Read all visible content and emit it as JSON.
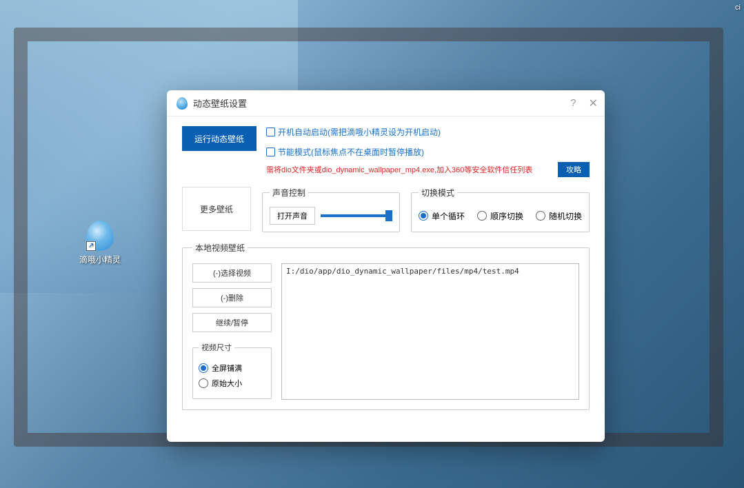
{
  "corner": "ci",
  "desktop_icon": {
    "label": "滴哦小精灵"
  },
  "dialog": {
    "title": "动态壁纸设置",
    "run_button": "运行动态壁纸",
    "autostart_label": "开机自动启动(需把滴哦小精灵设为开机启动)",
    "energy_label": "节能模式(鼠标焦点不在桌面时暂停播放)",
    "warn_text": "需将dio文件夹或dio_dynamic_wallpaper_mp4.exe,加入360等安全软件信任列表",
    "strategy_button": "攻略",
    "more_button": "更多壁纸",
    "audio": {
      "legend": "声音控制",
      "open_button": "打开声音",
      "value": 100
    },
    "switch": {
      "legend": "切换模式",
      "options": [
        "单个循环",
        "顺序切换",
        "随机切换"
      ],
      "selected": 0
    },
    "local": {
      "legend": "本地视频壁纸",
      "select_button": "(-)选择视频",
      "delete_button": "(-)删除",
      "resume_button": "继续/暂停",
      "size": {
        "legend": "视频尺寸",
        "options": [
          "全屏铺满",
          "原始大小"
        ],
        "selected": 0
      },
      "files": [
        "I:/dio/app/dio_dynamic_wallpaper/files/mp4/test.mp4"
      ]
    }
  }
}
